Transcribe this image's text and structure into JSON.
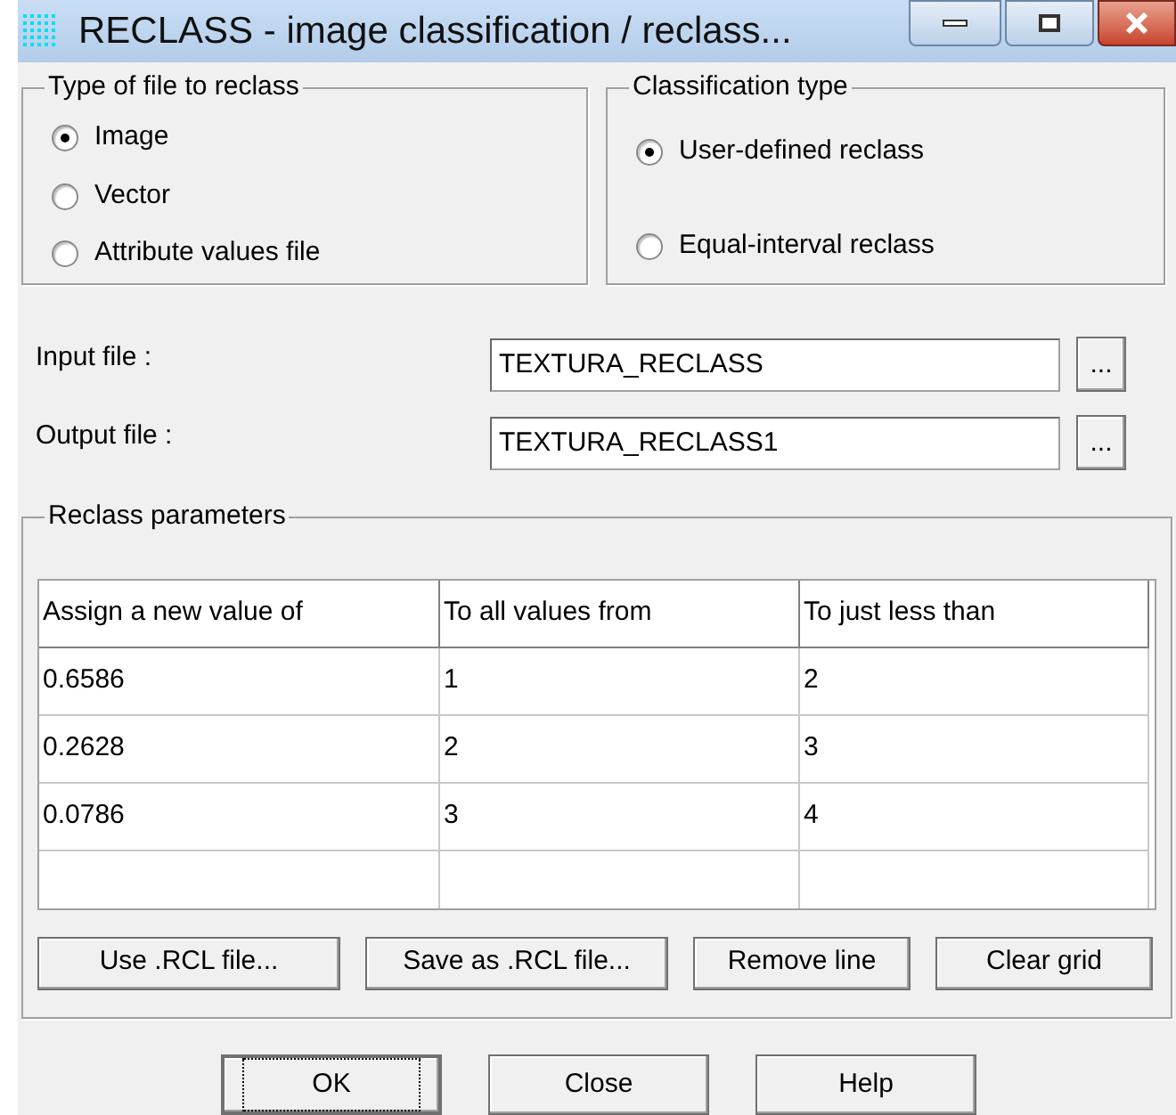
{
  "window": {
    "title": "RECLASS - image classification / reclass..."
  },
  "file_type": {
    "title": "Type of file to reclass",
    "options": [
      {
        "label": "Image",
        "selected": true
      },
      {
        "label": "Vector",
        "selected": false
      },
      {
        "label": "Attribute values file",
        "selected": false
      }
    ]
  },
  "classification_type": {
    "title": "Classification type",
    "options": [
      {
        "label": "User-defined reclass",
        "selected": true
      },
      {
        "label": "Equal-interval reclass",
        "selected": false
      }
    ]
  },
  "files": [
    {
      "label": "Input file :",
      "value": "TEXTURA_RECLASS",
      "browse": "..."
    },
    {
      "label": "Output file :",
      "value": "TEXTURA_RECLASS1",
      "browse": "..."
    }
  ],
  "parameters": {
    "title": "Reclass parameters",
    "columns": [
      "Assign a new value of",
      "To all values from",
      "To just less than"
    ],
    "rows": [
      [
        "0.6586",
        "1",
        "2"
      ],
      [
        "0.2628",
        "2",
        "3"
      ],
      [
        "0.0786",
        "3",
        "4"
      ]
    ],
    "buttons": [
      "Use .RCL file...",
      "Save as .RCL file...",
      "Remove line",
      "Clear grid"
    ]
  },
  "buttons": [
    {
      "label": "OK",
      "focused": true
    },
    {
      "label": "Close",
      "focused": false
    },
    {
      "label": "Help",
      "focused": false
    }
  ]
}
